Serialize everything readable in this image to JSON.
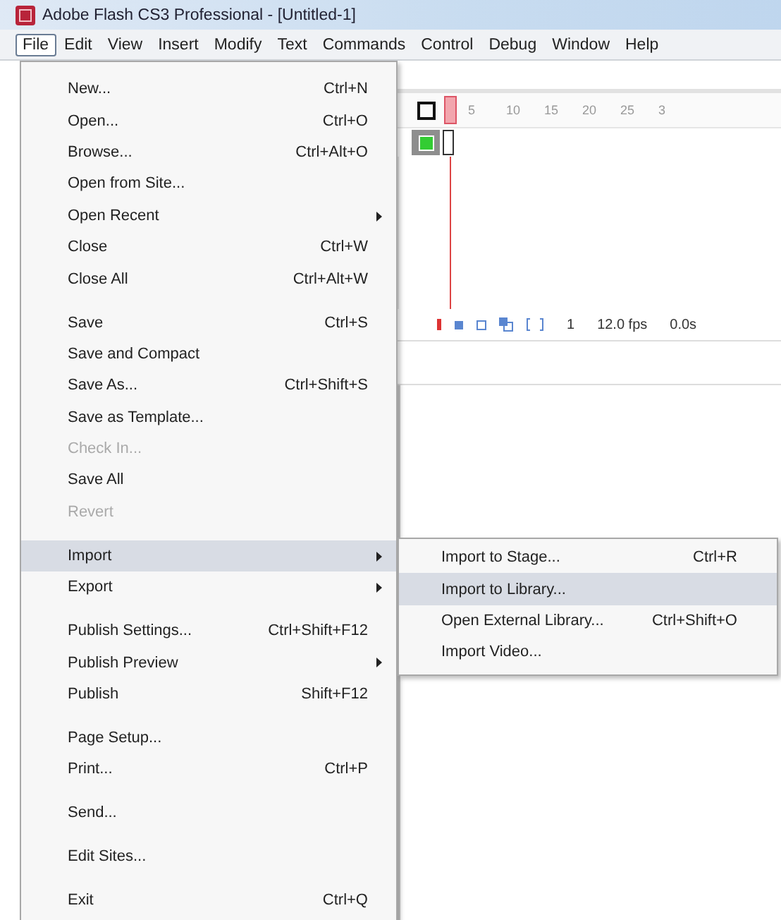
{
  "window": {
    "title": "Adobe Flash CS3 Professional - [Untitled-1]"
  },
  "menu_bar": [
    {
      "label": "File",
      "selected": true
    },
    {
      "label": "Edit",
      "selected": false
    },
    {
      "label": "View",
      "selected": false
    },
    {
      "label": "Insert",
      "selected": false
    },
    {
      "label": "Modify",
      "selected": false
    },
    {
      "label": "Text",
      "selected": false
    },
    {
      "label": "Commands",
      "selected": false
    },
    {
      "label": "Control",
      "selected": false
    },
    {
      "label": "Debug",
      "selected": false
    },
    {
      "label": "Window",
      "selected": false
    },
    {
      "label": "Help",
      "selected": false
    }
  ],
  "timeline": {
    "ruler": [
      "5",
      "10",
      "15",
      "20",
      "25",
      "3"
    ],
    "frame": "1",
    "frame_rate": "12.0 fps",
    "elapsed": "0.0s"
  },
  "file_menu": [
    {
      "kind": "item",
      "label": "New...",
      "shortcut": "Ctrl+N",
      "disabled": false,
      "submenu": false,
      "selected": false
    },
    {
      "kind": "item",
      "label": "Open...",
      "shortcut": "Ctrl+O",
      "disabled": false,
      "submenu": false,
      "selected": false
    },
    {
      "kind": "item",
      "label": "Browse...",
      "shortcut": "Ctrl+Alt+O",
      "disabled": false,
      "submenu": false,
      "selected": false
    },
    {
      "kind": "item",
      "label": "Open from Site...",
      "disabled": false,
      "submenu": false,
      "selected": false
    },
    {
      "kind": "item",
      "label": "Open Recent",
      "disabled": false,
      "submenu": true,
      "selected": false
    },
    {
      "kind": "item",
      "label": "Close",
      "shortcut": "Ctrl+W",
      "disabled": false,
      "submenu": false,
      "selected": false
    },
    {
      "kind": "item",
      "label": "Close All",
      "shortcut": "Ctrl+Alt+W",
      "disabled": false,
      "submenu": false,
      "selected": false
    },
    {
      "kind": "separator"
    },
    {
      "kind": "item",
      "label": "Save",
      "shortcut": "Ctrl+S",
      "disabled": false,
      "submenu": false,
      "selected": false
    },
    {
      "kind": "item",
      "label": "Save and Compact",
      "disabled": false,
      "submenu": false,
      "selected": false
    },
    {
      "kind": "item",
      "label": "Save As...",
      "shortcut": "Ctrl+Shift+S",
      "disabled": false,
      "submenu": false,
      "selected": false
    },
    {
      "kind": "item",
      "label": "Save as Template...",
      "disabled": false,
      "submenu": false,
      "selected": false
    },
    {
      "kind": "item",
      "label": "Check In...",
      "disabled": true,
      "submenu": false,
      "selected": false
    },
    {
      "kind": "item",
      "label": "Save All",
      "disabled": false,
      "submenu": false,
      "selected": false
    },
    {
      "kind": "item",
      "label": "Revert",
      "disabled": true,
      "submenu": false,
      "selected": false
    },
    {
      "kind": "separator"
    },
    {
      "kind": "item",
      "label": "Import",
      "disabled": false,
      "submenu": true,
      "selected": true
    },
    {
      "kind": "item",
      "label": "Export",
      "disabled": false,
      "submenu": true,
      "selected": false
    },
    {
      "kind": "separator"
    },
    {
      "kind": "item",
      "label": "Publish Settings...",
      "shortcut": "Ctrl+Shift+F12",
      "disabled": false,
      "submenu": false,
      "selected": false
    },
    {
      "kind": "item",
      "label": "Publish Preview",
      "disabled": false,
      "submenu": true,
      "selected": false
    },
    {
      "kind": "item",
      "label": "Publish",
      "shortcut": "Shift+F12",
      "disabled": false,
      "submenu": false,
      "selected": false
    },
    {
      "kind": "separator"
    },
    {
      "kind": "item",
      "label": "Page Setup...",
      "disabled": false,
      "submenu": false,
      "selected": false
    },
    {
      "kind": "item",
      "label": "Print...",
      "shortcut": "Ctrl+P",
      "disabled": false,
      "submenu": false,
      "selected": false
    },
    {
      "kind": "separator"
    },
    {
      "kind": "item",
      "label": "Send...",
      "disabled": false,
      "submenu": false,
      "selected": false
    },
    {
      "kind": "separator"
    },
    {
      "kind": "item",
      "label": "Edit Sites...",
      "disabled": false,
      "submenu": false,
      "selected": false
    },
    {
      "kind": "separator"
    },
    {
      "kind": "item",
      "label": "Exit",
      "shortcut": "Ctrl+Q",
      "disabled": false,
      "submenu": false,
      "selected": false
    }
  ],
  "import_submenu": [
    {
      "label": "Import to Stage...",
      "shortcut": "Ctrl+R",
      "selected": false
    },
    {
      "label": "Import to Library...",
      "selected": true
    },
    {
      "label": "Open External Library...",
      "shortcut": "Ctrl+Shift+O",
      "selected": false
    },
    {
      "label": "Import Video...",
      "selected": false
    }
  ]
}
